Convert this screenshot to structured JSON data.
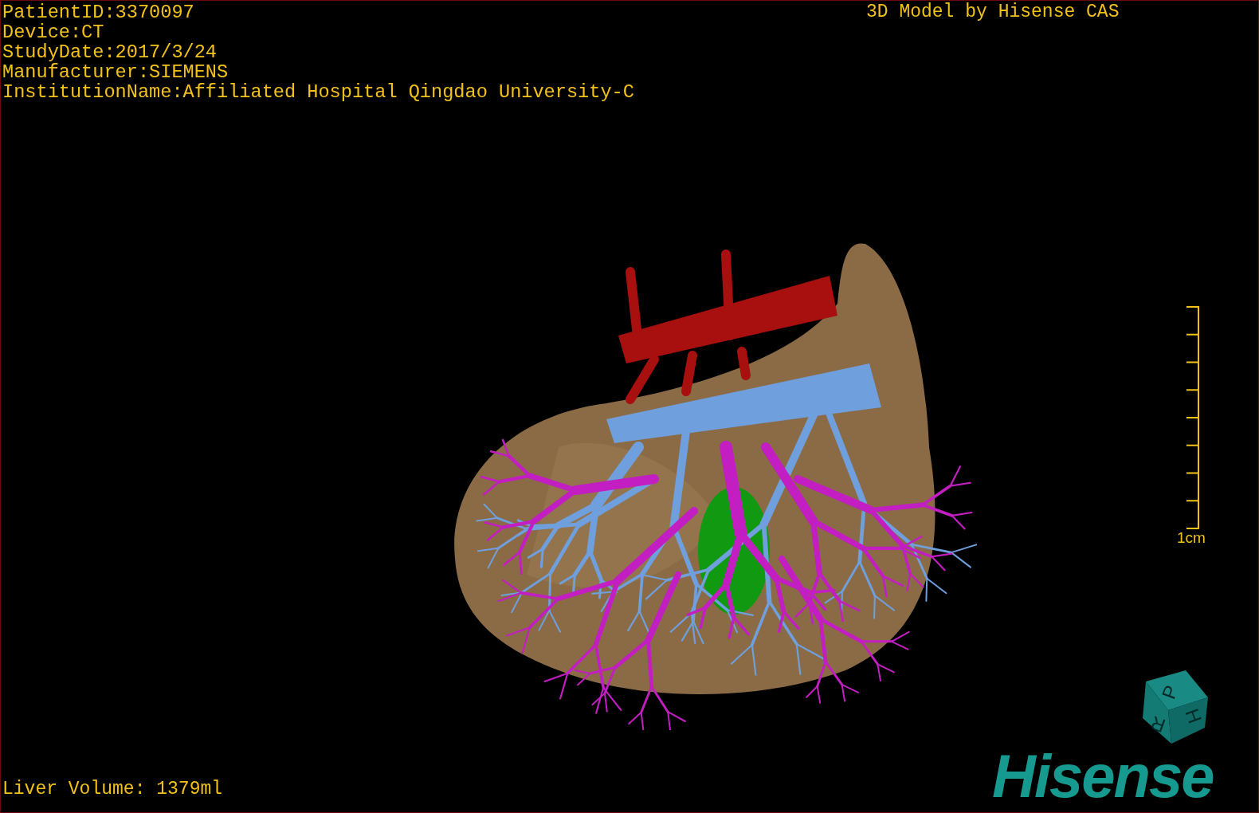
{
  "viewer": {
    "title": "3D Model by Hisense CAS",
    "info_lines": [
      "PatientID:3370097",
      "Device:CT",
      "StudyDate:2017/3/24",
      "Manufacturer:SIEMENS",
      "InstitutionName:Affiliated Hospital Qingdao University-C"
    ],
    "scale_bar": {
      "label": "1cm"
    },
    "orientation_cube": {
      "faces": [
        "P",
        "H",
        "R"
      ]
    },
    "logo": "Hisense",
    "status": "Liver Volume: 1379ml"
  }
}
